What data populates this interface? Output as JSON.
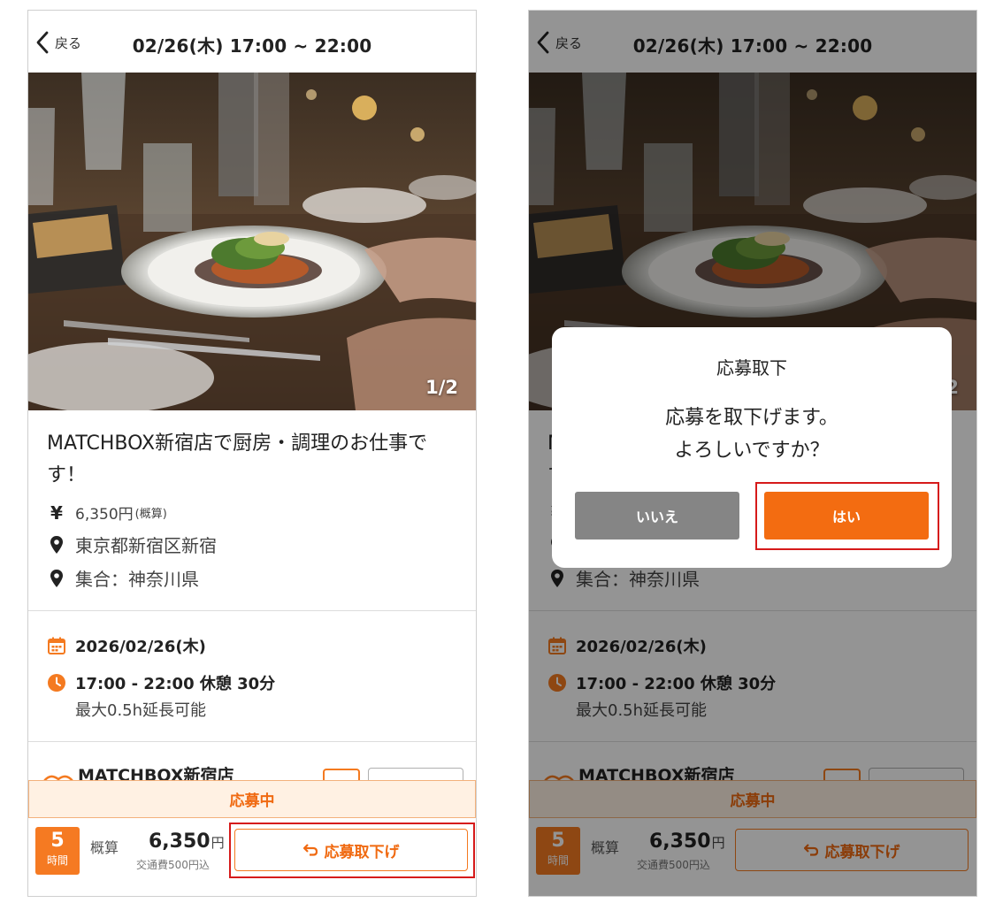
{
  "header": {
    "back_label": "戻る",
    "title": "02/26(木) 17:00 ~ 22:00"
  },
  "photo": {
    "counter": "1/2"
  },
  "job": {
    "title": "MATCHBOX新宿店で厨房・調理のお仕事です！",
    "wage": "6,350円",
    "wage_note": "(概算)",
    "address": "東京都新宿区新宿",
    "meeting_place": "集合：神奈川県"
  },
  "schedule": {
    "date": "2026/02/26(木)",
    "time": "17:00 - 22:00 休憩 30分",
    "extension": "最大0.5h延長可能"
  },
  "store": {
    "name": "MATCHBOX新宿店"
  },
  "status": {
    "label": "応募中"
  },
  "bottom": {
    "hours_value": "5",
    "hours_unit": "時間",
    "approx_label": "概算",
    "price": "6,350",
    "price_unit": "円",
    "transport_note": "交通費500円込",
    "withdraw_label": "応募取下げ"
  },
  "dialog": {
    "title": "応募取下",
    "message_line1": "応募を取下げます。",
    "message_line2": "よろしいですか？",
    "no_label": "いいえ",
    "yes_label": "はい"
  },
  "colors": {
    "accent": "#F36C11",
    "status_bg": "#FFF1E3",
    "highlight": "#D61A1A",
    "no_button": "#858585"
  },
  "icons": [
    "chevron-left-icon",
    "yen-icon",
    "location-pin-icon",
    "calendar-icon",
    "clock-icon",
    "return-arrow-icon",
    "store-logo-icon"
  ]
}
